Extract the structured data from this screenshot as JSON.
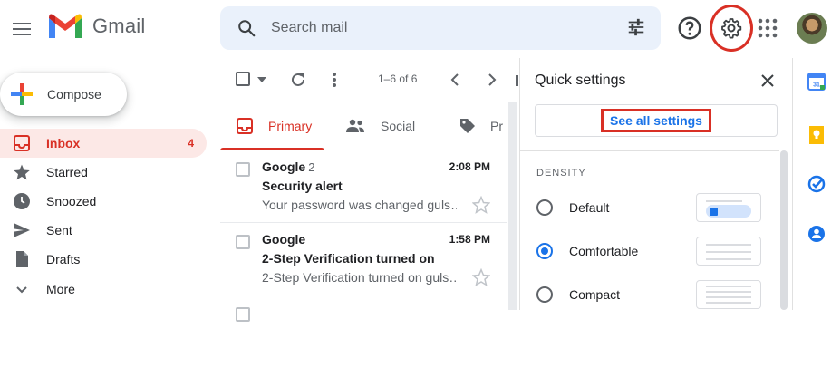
{
  "header": {
    "app_name": "Gmail",
    "search_placeholder": "Search mail",
    "icons": [
      "menu-icon",
      "gmail-logo",
      "search-icon",
      "tune-icon",
      "help-icon",
      "settings-icon",
      "apps-icon",
      "avatar"
    ]
  },
  "sidebar": {
    "compose_label": "Compose",
    "items": [
      {
        "label": "Inbox",
        "count": "4",
        "icon": "inbox-icon",
        "active": true
      },
      {
        "label": "Starred",
        "count": "",
        "icon": "star-icon"
      },
      {
        "label": "Snoozed",
        "count": "",
        "icon": "clock-icon"
      },
      {
        "label": "Sent",
        "count": "",
        "icon": "send-icon"
      },
      {
        "label": "Drafts",
        "count": "",
        "icon": "draft-icon"
      },
      {
        "label": "More",
        "count": "",
        "icon": "chevron-down-icon"
      }
    ]
  },
  "toolbar": {
    "range": "1–6 of 6"
  },
  "tabs": [
    {
      "label": "Primary",
      "active": true
    },
    {
      "label": "Social"
    },
    {
      "label": "Pr"
    }
  ],
  "emails": [
    {
      "sender": "Google",
      "count": "2",
      "time": "2:08 PM",
      "subject": "Security alert",
      "snippet": "Your password was changed guls…"
    },
    {
      "sender": "Google",
      "count": "",
      "time": "1:58 PM",
      "subject": "2-Step Verification turned on",
      "snippet": "2-Step Verification turned on guls…"
    }
  ],
  "quick_settings": {
    "title": "Quick settings",
    "see_all": "See all settings",
    "density_heading": "DENSITY",
    "density_options": [
      {
        "label": "Default",
        "selected": false
      },
      {
        "label": "Comfortable",
        "selected": true
      },
      {
        "label": "Compact",
        "selected": false
      }
    ]
  },
  "colors": {
    "accent_red": "#d93025",
    "link_blue": "#1a73e8",
    "search_bg": "#eaf1fb",
    "active_nav_bg": "#fce8e6"
  }
}
